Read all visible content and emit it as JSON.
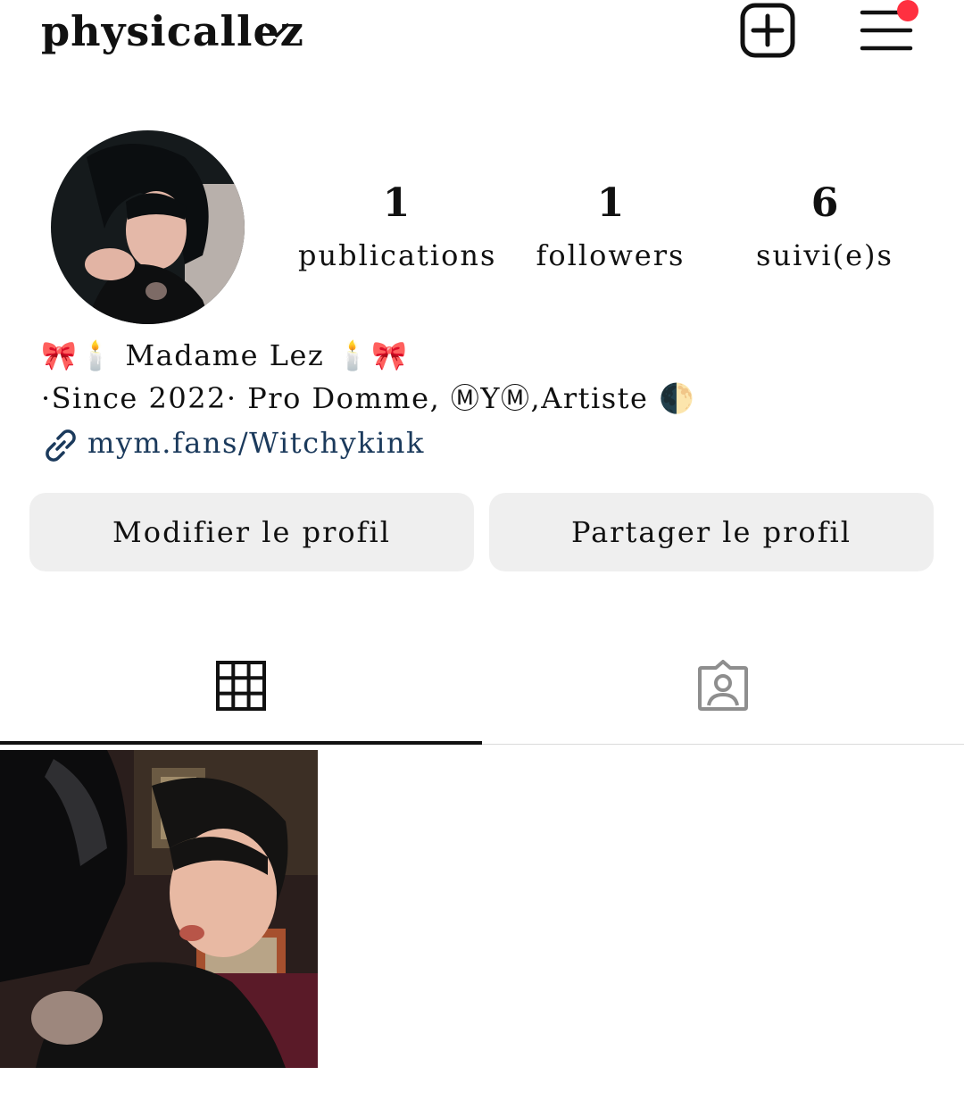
{
  "header": {
    "username": "physicallez",
    "dropdown_icon": "chevron-down-icon",
    "create_icon": "plus-square-icon",
    "menu_icon": "hamburger-menu-icon",
    "notification_color": "#ff3040"
  },
  "profile": {
    "avatar": "profile-photo",
    "stats": [
      {
        "value": "1",
        "label": "publications"
      },
      {
        "value": "1",
        "label": "followers"
      },
      {
        "value": "6",
        "label": "suivi(e)s"
      }
    ]
  },
  "bio": {
    "line1": "🎀🕯️ Madame Lez 🕯️🎀",
    "line2": "·Since 2022· Pro Domme, ⓂYⓂ,Artiste 🌓",
    "link": "mym.fans/Witchykink",
    "link_color": "#1b3a5c"
  },
  "actions": {
    "edit_label": "Modifier le profil",
    "share_label": "Partager le profil"
  },
  "tabs": {
    "grid_icon": "grid-icon",
    "tagged_icon": "tagged-person-icon"
  }
}
